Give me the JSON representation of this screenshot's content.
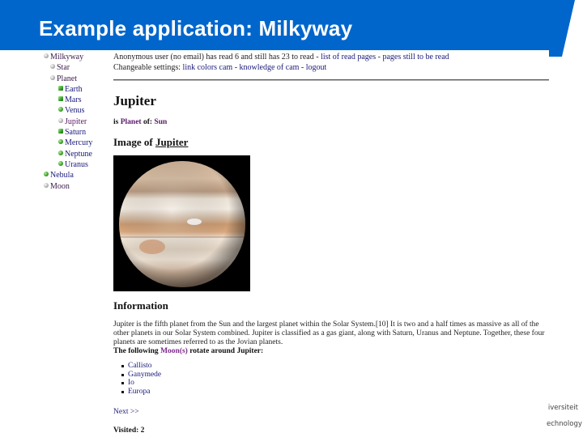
{
  "slide": {
    "title": "Example application: Milkyway",
    "brand_color": "#0066cc",
    "footer_lines": [
      "iversiteit",
      "echnology"
    ]
  },
  "tree": {
    "items": [
      {
        "label": "Milkyway",
        "level": 0,
        "icon": "grey-bullet-icon",
        "color": "dark"
      },
      {
        "label": "Star",
        "level": 1,
        "icon": "grey-bullet-icon",
        "color": "dark"
      },
      {
        "label": "Planet",
        "level": 1,
        "icon": "grey-bullet-icon",
        "color": "dark"
      },
      {
        "label": "Earth",
        "level": 2,
        "icon": "green-square-bullet-icon",
        "color": "blue"
      },
      {
        "label": "Mars",
        "level": 2,
        "icon": "green-square-bullet-icon",
        "color": "blue"
      },
      {
        "label": "Venus",
        "level": 2,
        "icon": "green-bullet-icon",
        "color": "blue"
      },
      {
        "label": "Jupiter",
        "level": 2,
        "icon": "grey-bullet-icon",
        "color": "purple"
      },
      {
        "label": "Saturn",
        "level": 2,
        "icon": "green-square-bullet-icon",
        "color": "blue"
      },
      {
        "label": "Mercury",
        "level": 2,
        "icon": "green-bullet-icon",
        "color": "blue"
      },
      {
        "label": "Neptune",
        "level": 2,
        "icon": "green-bullet-icon",
        "color": "blue"
      },
      {
        "label": "Uranus",
        "level": 2,
        "icon": "green-bullet-icon",
        "color": "blue"
      },
      {
        "label": "Nebula",
        "level": 0,
        "icon": "green-bullet-icon",
        "color": "blue"
      },
      {
        "label": "Moon",
        "level": 0,
        "icon": "grey-bullet-icon",
        "color": "dark"
      }
    ]
  },
  "status": {
    "line1_text": "Anonymous user (no email) has read 6 and still has 23 to read - ",
    "read_pages_link": "list of read pages",
    "separator": " - ",
    "unread_pages_link": "pages still to be read",
    "line2_prefix": "Changeable settings: ",
    "link_colors_link": "link colors cam",
    "knowledge_link": "knowledge of cam",
    "logout_link": "logout"
  },
  "page": {
    "title": "Jupiter",
    "planet_of_label": "is ",
    "planet_of_link": "Planet",
    "planet_of_mid": " of: ",
    "planet_of_value": "Sun",
    "image_heading_prefix": "Image of ",
    "image_heading_link": "Jupiter",
    "image_alt": "Jupiter planet photo",
    "info_heading": "Information",
    "info_text": "Jupiter is the fifth planet from the Sun and the largest planet within the Solar System.[10] It is two and a half times as massive as all of the other planets in our Solar System combined. Jupiter is classified as a gas giant, along with Saturn, Uranus and Neptune. Together, these four planets are sometimes referred to as the Jovian planets.",
    "moons_prefix": "The following ",
    "moons_link": "Moon(s)",
    "moons_suffix": " rotate around Jupiter:",
    "moons": [
      "Callisto",
      "Ganymede",
      "Io",
      "Europa"
    ],
    "next_link": "Next >>",
    "visited": "Visited: 2"
  }
}
